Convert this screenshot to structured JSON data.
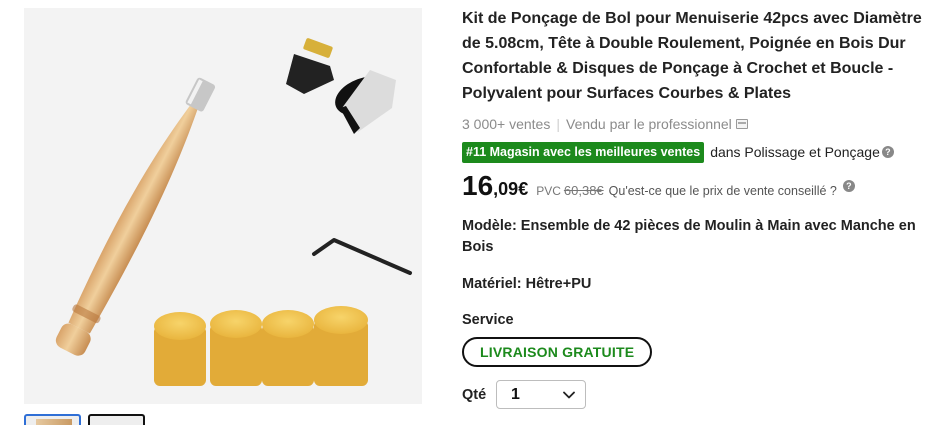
{
  "product": {
    "title": "Kit de Ponçage de Bol pour Menuiserie 42pcs avec Diamètre de 5.08cm, Tête à Double Roulement, Poignée en Bois Dur Confortable & Disques de Ponçage à Crochet et Boucle - Polyvalent pour Surfaces Courbes & Plates",
    "sales": "3 000+ ventes",
    "seller": "Vendu par le professionnel",
    "rank_badge": "#11 Magasin avec les meilleures ventes",
    "rank_category": "dans Polissage et Ponçage",
    "price_integer": "16",
    "price_decimal": ",09",
    "price_currency": "€",
    "pvc_label": "PVC",
    "pvc_value": "60,38€",
    "pvc_question": "Qu'est-ce que le prix de vente conseillé ?",
    "model": "Modèle: Ensemble de 42 pièces de Moulin à Main avec Manche en Bois",
    "material": "Matériel: Hêtre+PU",
    "service_label": "Service",
    "service_option": "LIVRAISON GRATUITE",
    "qty_label": "Qté",
    "qty_value": "1"
  },
  "icons": {
    "help": "question-circle-icon",
    "seller": "shop-icon",
    "qty_chevron": "chevron-down-icon"
  },
  "colors": {
    "rank_badge_bg": "#1c8a1c",
    "service_text": "#1c8a1c",
    "thumb_active_border": "#2f6fd6"
  }
}
